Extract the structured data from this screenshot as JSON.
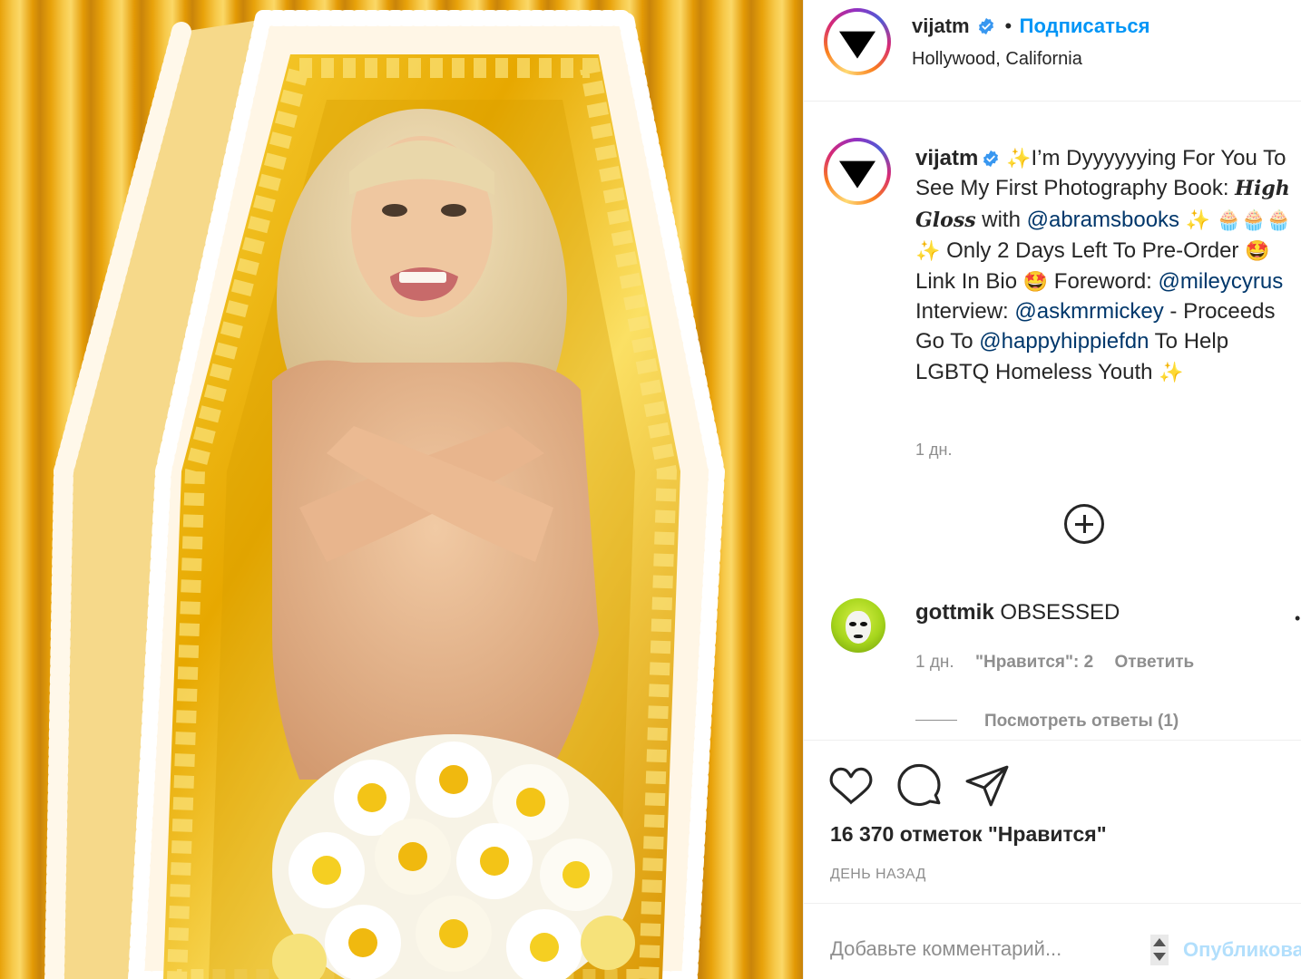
{
  "post": {
    "username": "vijatm",
    "follow_label": "Подписаться",
    "follow_separator": "•",
    "location": "Hollywood, California",
    "caption": {
      "emoji_sparkles": "✨",
      "emoji_cupcake": "🧁",
      "emoji_star_eyes": "🤩",
      "part1": "I’m Dyyyyyying For You To See My First Photography Book: ",
      "book_title": "High Gloss",
      "part2": " with ",
      "mention_publisher": "@abramsbooks",
      "part3": " Only 2 Days Left To Pre-Order ",
      "part4": "Link In Bio ",
      "part5": " Foreword: ",
      "mention_foreword": "@mileycyrus",
      "part6": " Interview: ",
      "mention_interview": "@askmrmickey",
      "part7": " - Proceeds Go To ",
      "mention_charity": "@happyhippiefdn",
      "part8": " To Help LGBTQ Homeless Youth "
    },
    "caption_time": "1 дн.",
    "likes_text": "16 370 отметок \"Нравится\"",
    "date_text": "ДЕНЬ НАЗАД"
  },
  "comments": [
    {
      "username": "gottmik",
      "text": "OBSESSED",
      "time": "1 дн.",
      "likes": "\"Нравится\": 2",
      "reply_label": "Ответить",
      "view_replies": "Посмотреть ответы (1)"
    }
  ],
  "add_comment": {
    "placeholder": "Добавьте комментарий...",
    "publish_label": "Опубликовать"
  },
  "colors": {
    "accent": "#0095f6",
    "mention": "#00376b",
    "muted": "#8e8e8e",
    "publish_disabled": "#b2dffc",
    "curtain": "#f2b51f",
    "coffin_satin": "#f5c21a"
  },
  "icons": {
    "verified": "verified-badge-icon",
    "load_more": "plus-circle-icon",
    "like": "heart-icon",
    "comment": "speech-bubble-icon",
    "share": "paper-plane-icon"
  }
}
